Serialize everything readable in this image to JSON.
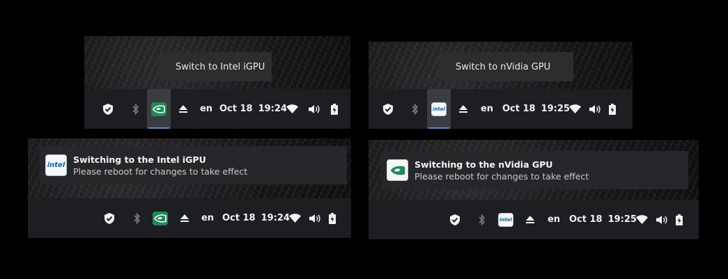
{
  "tooltips": {
    "to_intel": "Switch to Intel iGPU",
    "to_nvidia": "Switch to nVidia GPU"
  },
  "panels": [
    {
      "lang": "en",
      "date": "Oct 18",
      "time": "19:24",
      "gpu_icon": "nvidia-icon",
      "gpu_selected": true
    },
    {
      "lang": "en",
      "date": "Oct 18",
      "time": "19:25",
      "gpu_icon": "intel-icon",
      "gpu_selected": true
    },
    {
      "lang": "en",
      "date": "Oct 18",
      "time": "19:24",
      "gpu_icon": "nvidia-icon",
      "gpu_selected": false
    },
    {
      "lang": "en",
      "date": "Oct 18",
      "time": "19:25",
      "gpu_icon": "intel-icon",
      "gpu_selected": false
    }
  ],
  "notifications": [
    {
      "icon": "intel-icon",
      "icon_text": "intel",
      "title": "Switching to the Intel iGPU",
      "body": "Please reboot for changes to take effect"
    },
    {
      "icon": "nvidia-icon",
      "title": "Switching to the nVidia GPU",
      "body": "Please reboot for changes to take effect"
    }
  ],
  "icons": [
    "shield-icon",
    "bluetooth-icon",
    "eject-icon",
    "wifi-icon",
    "volume-icon",
    "battery-icon"
  ],
  "colors": {
    "panel_bg": "#1d1e22",
    "tooltip_bg": "#2d2d30",
    "notification_bg": "#26272b",
    "nvidia_green": "#1c8a5b",
    "intel_blue": "#0068b5",
    "active_underline": "#4a90d9"
  }
}
